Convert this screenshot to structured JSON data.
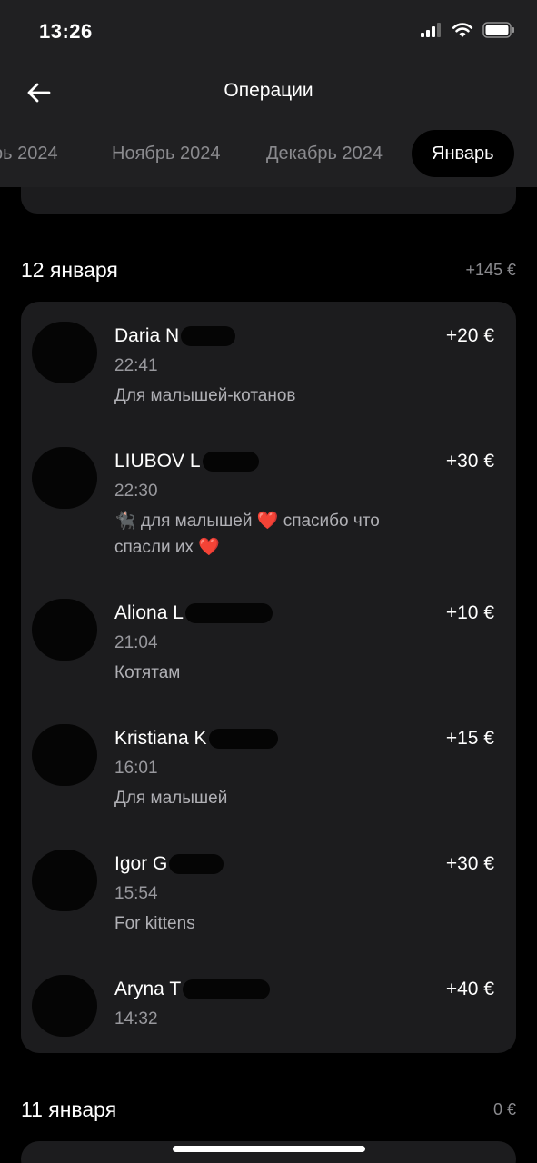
{
  "status": {
    "time": "13:26"
  },
  "header": {
    "title": "Операции",
    "tabs": [
      {
        "label": "рь 2024",
        "active": false
      },
      {
        "label": "Ноябрь 2024",
        "active": false
      },
      {
        "label": "Декабрь 2024",
        "active": false
      },
      {
        "label": "Январь",
        "active": true
      }
    ]
  },
  "days": [
    {
      "title": "12 января",
      "total": "+145 €",
      "operations": [
        {
          "name": "Daria N",
          "amount": "+20 €",
          "time": "22:41",
          "comment": "Для малышей-котанов"
        },
        {
          "name": "LIUBOV L",
          "amount": "+30 €",
          "time": "22:30",
          "comment_parts": [
            "🐈‍⬛ для малышей ",
            "❤️",
            " спасибо что спасли их ",
            "❤️"
          ]
        },
        {
          "name": "Aliona L",
          "amount": "+10 €",
          "time": "21:04",
          "comment": "Котятам"
        },
        {
          "name": "Kristiana K",
          "amount": "+15 €",
          "time": "16:01",
          "comment": "Для малышей"
        },
        {
          "name": "Igor G",
          "amount": "+30 €",
          "time": "15:54",
          "comment": "For kittens"
        },
        {
          "name": "Aryna T",
          "amount": "+40 €",
          "time": "14:32",
          "comment": ""
        }
      ]
    },
    {
      "title": "11 января",
      "total": "0 €"
    }
  ],
  "colors": {
    "background": "#000000",
    "card": "#1c1c1e",
    "header": "#202022",
    "muted": "#8a8a8e",
    "heart": "#e0192b"
  },
  "icons": [
    "back-arrow-icon",
    "signal-icon",
    "wifi-icon",
    "battery-icon"
  ]
}
